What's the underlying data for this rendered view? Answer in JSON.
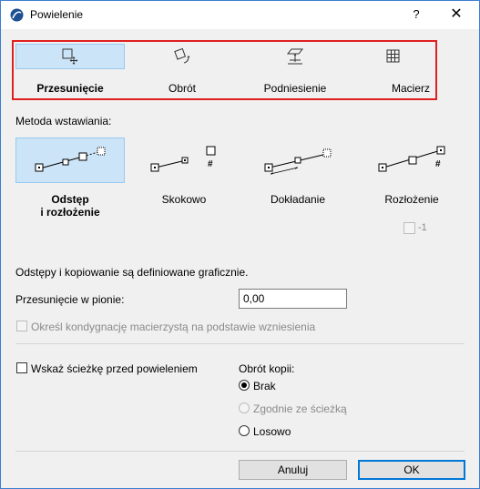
{
  "window": {
    "title": "Powielenie",
    "help_label": "?",
    "close_label": "✕"
  },
  "tabs": [
    {
      "label": "Przesunięcie",
      "icon": "move-icon",
      "selected": true
    },
    {
      "label": "Obrót",
      "icon": "rotate-icon",
      "selected": false
    },
    {
      "label": "Podniesienie",
      "icon": "elevate-icon",
      "selected": false
    },
    {
      "label": "Macierz",
      "icon": "matrix-icon",
      "selected": false
    }
  ],
  "method": {
    "label": "Metoda wstawiania:",
    "options": [
      {
        "line1": "Odstęp",
        "line2": "i rozłożenie",
        "selected": true
      },
      {
        "line1": "Skokowo",
        "line2": "",
        "selected": false
      },
      {
        "line1": "Dokładanie",
        "line2": "",
        "selected": false
      },
      {
        "line1": "Rozłożenie",
        "line2": "",
        "selected": false
      }
    ],
    "hash_label": "#",
    "minus_one_label": "-1"
  },
  "info_text": "Odstępy i kopiowanie są definiowane graficznie.",
  "vertical_offset": {
    "label": "Przesunięcie w pionie:",
    "value": "0,00"
  },
  "master_story_label": "Określ kondygnację macierzystą na podstawie wzniesienia",
  "show_path_label": "Wskaż ścieżkę przed powieleniem",
  "rotation": {
    "label": "Obrót kopii:",
    "options": [
      {
        "label": "Brak",
        "checked": true,
        "disabled": false
      },
      {
        "label": "Zgodnie ze ścieżką",
        "checked": false,
        "disabled": true
      },
      {
        "label": "Losowo",
        "checked": false,
        "disabled": false
      }
    ]
  },
  "buttons": {
    "cancel": "Anuluj",
    "ok": "OK"
  },
  "colors": {
    "selected_bg": "#cce4f7",
    "highlight_border": "#e02020",
    "default_button_border": "#0078d7"
  }
}
